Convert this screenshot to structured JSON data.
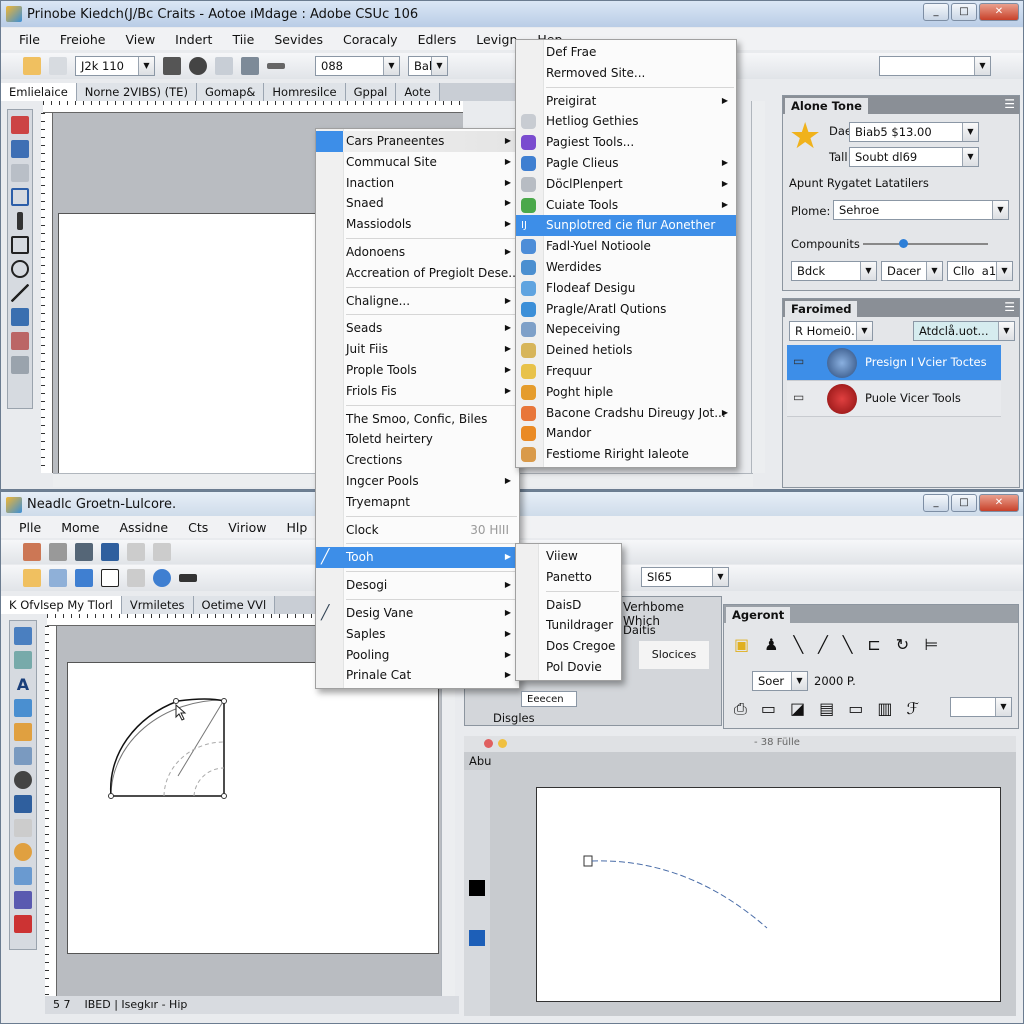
{
  "top_window": {
    "title": "Prinobe Kiedch(J/Bc Craits - Aotoe ıMdage : Adobe CSUc 106",
    "menu": [
      "File",
      "Freiohe",
      "View",
      "Indert",
      "Tiie",
      "Sevides",
      "Coracaly",
      "Edlers",
      "Levign",
      "Hep"
    ],
    "toolbar": {
      "zoom_value": "J2k 110",
      "font_value": "088",
      "style_value": "Bal.",
      "right_combo": ""
    },
    "tabs": [
      "Emlielaice",
      "Norne 2VIBS) (TE)",
      "Gomap&",
      "Homresilce",
      "Gppal",
      "Aote"
    ],
    "status_strip": ""
  },
  "menu_main": {
    "items": [
      {
        "label": "Cars Praneentes",
        "arrow": true,
        "hl": "icon"
      },
      {
        "label": "Commucal Site",
        "arrow": true
      },
      {
        "label": "Inaction",
        "arrow": true
      },
      {
        "label": "Snaed",
        "arrow": true
      },
      {
        "label": "Massiodols",
        "arrow": true,
        "sep_after": true
      },
      {
        "label": "Adonoens",
        "arrow": true
      },
      {
        "label": "Accreation of Pregiolt Dese...",
        "sep_after": true
      },
      {
        "label": "Chaligne...",
        "arrow": true,
        "sep_after": true
      },
      {
        "label": "Seads",
        "arrow": true
      },
      {
        "label": "Juit Fiis",
        "arrow": true
      },
      {
        "label": "Prople Tools",
        "arrow": true
      },
      {
        "label": "Friols Fis",
        "arrow": true,
        "sep_after": true
      },
      {
        "label": "The Smoo, Confic, Biles"
      },
      {
        "label": "Toletd heirtery"
      },
      {
        "label": "Crections"
      },
      {
        "label": "Ingcer Pools",
        "arrow": true
      },
      {
        "label": "Tryemapnt",
        "sep_after": true
      },
      {
        "label": "Clock",
        "shortcut": "30 HIII",
        "sep_after": true
      },
      {
        "label": "Tooh",
        "arrow": true,
        "hl": "full",
        "icon": "brush-icon",
        "sep_after": true
      },
      {
        "label": "Desogi",
        "arrow": true,
        "sep_after": true
      },
      {
        "label": "Desig Vane",
        "arrow": true,
        "icon": "brush-icon"
      },
      {
        "label": "Saples",
        "arrow": true
      },
      {
        "label": "Pooling",
        "arrow": true
      },
      {
        "label": "Prinale Cat",
        "arrow": true
      }
    ]
  },
  "menu_sub": {
    "items": [
      {
        "label": "Def Frae"
      },
      {
        "label": "Rermoved Site...",
        "sep_after": true
      },
      {
        "label": "Preigirat",
        "arrow": true
      },
      {
        "label": "Hetliog Gethies",
        "icon": "doc-icon",
        "color": "#c8ccd2"
      },
      {
        "label": "Pagiest Tools...",
        "icon": "tools-icon",
        "color": "#7a4ccf"
      },
      {
        "label": "Pagle Clieus",
        "arrow": true,
        "icon": "page-icon",
        "color": "#3f7fd1"
      },
      {
        "label": "DöclPlenpert",
        "arrow": true,
        "icon": "cylinder-icon",
        "color": "#b7bcc3"
      },
      {
        "label": "Cuiate Tools",
        "arrow": true,
        "icon": "puzzle-icon",
        "color": "#4aa84a"
      },
      {
        "label": "Sunplotred cie flur Aonether",
        "hl": "full",
        "icon": "tool-icon"
      },
      {
        "label": "Fadl-Yuel Notioole",
        "icon": "grid-icon",
        "color": "#4d8dd8"
      },
      {
        "label": "Werdides",
        "icon": "globe-icon",
        "color": "#4b8fd0"
      },
      {
        "label": "Flodeaf Desigu",
        "icon": "sphere-icon",
        "color": "#60a4e0"
      },
      {
        "label": "Pragle/Aratl Qutions",
        "icon": "anchor-icon",
        "color": "#3c8fd8"
      },
      {
        "label": "Nepeceiving",
        "icon": "chart-icon",
        "color": "#7ea0c8"
      },
      {
        "label": "Deined hetiols",
        "icon": "bars-icon",
        "color": "#d7b55a"
      },
      {
        "label": "Frequur",
        "icon": "face-icon",
        "color": "#e8c24a"
      },
      {
        "label": "Poght hiple",
        "icon": "person-icon",
        "color": "#e59c2c"
      },
      {
        "label": "Bacone Cradshu Direugy Jot...",
        "arrow": true,
        "icon": "bowl-icon",
        "color": "#e8763a"
      },
      {
        "label": "Mandor",
        "icon": "fox-icon",
        "color": "#ea8a24"
      },
      {
        "label": "Festiome Riright Ialeote",
        "icon": "palette-icon",
        "color": "#d99a4a"
      }
    ]
  },
  "menu_tooh": {
    "items": [
      {
        "label": "Viiew"
      },
      {
        "label": "Panetto",
        "sep_after": true
      },
      {
        "label": "DaisD"
      },
      {
        "label": "Tunildrager"
      },
      {
        "label": "Dos Cregoe"
      },
      {
        "label": "Pol Dovie"
      }
    ]
  },
  "right_panel": {
    "tab": "Alone Tone",
    "field1_label": "Dae",
    "field1_value": "Biab5 $13.00",
    "field2_label": "Tall",
    "field2_value": "Soubt dl69",
    "section": "Apunt Rygatet Latatilers",
    "plane_label": "Plome:",
    "plane_value": "Sehroe",
    "components_label": "Compounits",
    "slider_value": 0.3,
    "combo_a": "Bdck",
    "combo_b": "Dacer",
    "combo_c": "Cllo  a1",
    "layers_tab": "Faroimed",
    "layers_filter": "R Homei0...",
    "layers_action": "Atdclå.uot...",
    "layers": [
      {
        "name": "Presign I Vcier Toctes",
        "selected": true,
        "icon": "sphere-icon"
      },
      {
        "name": "Puole Vicer Tools",
        "selected": false,
        "icon": "t-logo-icon"
      }
    ],
    "accent": "#3d8ee8"
  },
  "bottom_window": {
    "title": "Neadlc Groetn-Lulcore.",
    "menu": [
      "Plle",
      "Mome",
      "Assidne",
      "Cts",
      "Viriow",
      "Hlp"
    ],
    "tabs": [
      "K Ofvlsep My Tlorl",
      "Vrmiletes",
      "Oetime VVl"
    ],
    "combo_value": "Sl65",
    "panel_title": "Verhbome Which",
    "panel_sub": "Daitis",
    "panel_button": "Slocices",
    "agent_tab": "Ageront",
    "agent_combo": "Soer",
    "agent_value": "2000 P.",
    "small_field": "Eeecen",
    "disgles_label": "Disgles",
    "aux_label": "Abu",
    "canvas_header": "- 38 Fülle",
    "status": "IBED | Isegkır - Hip",
    "status_page": "5 7"
  }
}
